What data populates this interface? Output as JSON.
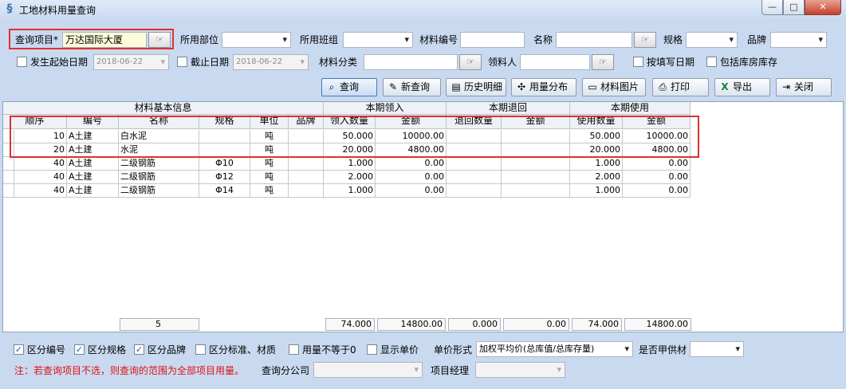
{
  "window": {
    "title": "工地材料用量查询",
    "min_glyph": "—",
    "max_glyph": "□",
    "close_glyph": "✕"
  },
  "filters": {
    "project_label": "查询项目*",
    "project_value": "万达国际大厦",
    "dept_label": "所用部位",
    "team_label": "所用班组",
    "material_code_label": "材料编号",
    "name_label": "名称",
    "spec_label": "规格",
    "brand_label": "品牌",
    "start_date_label": "发生起始日期",
    "start_date_value": "2018-06-22",
    "end_date_label": "截止日期",
    "end_date_value": "2018-06-22",
    "category_label": "材料分类",
    "receiver_label": "领料人",
    "fill_date_label": "按填写日期",
    "include_warehouse_label": "包括库房库存"
  },
  "toolbar": {
    "query": "查询",
    "new_query": "新查询",
    "history": "历史明细",
    "usage_dist": "用量分布",
    "material_pics": "材料图片",
    "print": "打印",
    "export": "导出",
    "close": "关闭"
  },
  "grid": {
    "groups": [
      "材料基本信息",
      "本期领入",
      "本期退回",
      "本期使用"
    ],
    "columns": [
      "顺序",
      "编号",
      "名称",
      "规格",
      "单位",
      "品牌",
      "领入数量",
      "金额",
      "退回数量",
      "金额",
      "使用数量",
      "金额"
    ],
    "rows": [
      {
        "seq": "10",
        "code": "A土建",
        "name": "白水泥",
        "spec": "",
        "unit": "吨",
        "brand": "",
        "in_qty": "50.000",
        "in_amt": "10000.00",
        "ret_qty": "",
        "ret_amt": "",
        "use_qty": "50.000",
        "use_amt": "10000.00"
      },
      {
        "seq": "20",
        "code": "A土建",
        "name": "水泥",
        "spec": "",
        "unit": "吨",
        "brand": "",
        "in_qty": "20.000",
        "in_amt": "4800.00",
        "ret_qty": "",
        "ret_amt": "",
        "use_qty": "20.000",
        "use_amt": "4800.00"
      },
      {
        "seq": "40",
        "code": "A土建",
        "name": "二级钢筋",
        "spec": "Φ10",
        "unit": "吨",
        "brand": "",
        "in_qty": "1.000",
        "in_amt": "0.00",
        "ret_qty": "",
        "ret_amt": "",
        "use_qty": "1.000",
        "use_amt": "0.00"
      },
      {
        "seq": "40",
        "code": "A土建",
        "name": "二级钢筋",
        "spec": "Φ12",
        "unit": "吨",
        "brand": "",
        "in_qty": "2.000",
        "in_amt": "0.00",
        "ret_qty": "",
        "ret_amt": "",
        "use_qty": "2.000",
        "use_amt": "0.00"
      },
      {
        "seq": "40",
        "code": "A土建",
        "name": "二级钢筋",
        "spec": "Φ14",
        "unit": "吨",
        "brand": "",
        "in_qty": "1.000",
        "in_amt": "0.00",
        "ret_qty": "",
        "ret_amt": "",
        "use_qty": "1.000",
        "use_amt": "0.00"
      }
    ],
    "summary": {
      "count": "5",
      "in_qty": "74.000",
      "in_amt": "14800.00",
      "ret_qty": "0.000",
      "ret_amt": "0.00",
      "use_qty": "74.000",
      "use_amt": "14800.00"
    }
  },
  "options": {
    "by_code": "区分编号",
    "by_spec": "区分规格",
    "by_brand": "区分品牌",
    "by_standard": "区分标准、材质",
    "usage_not_equal": "用量不等于0",
    "show_price": "显示单价",
    "price_form_label": "单价形式",
    "price_form_value": "加权平均价(总库值/总库存量)",
    "owner_supply_label": "是否甲供材",
    "note": "注：若查询项目不选，则查询的范围为全部项目用量。",
    "branch_label": "查询分公司",
    "manager_label": "项目经理"
  },
  "colors": {
    "highlight": "#e03030",
    "note": "#e01010"
  }
}
